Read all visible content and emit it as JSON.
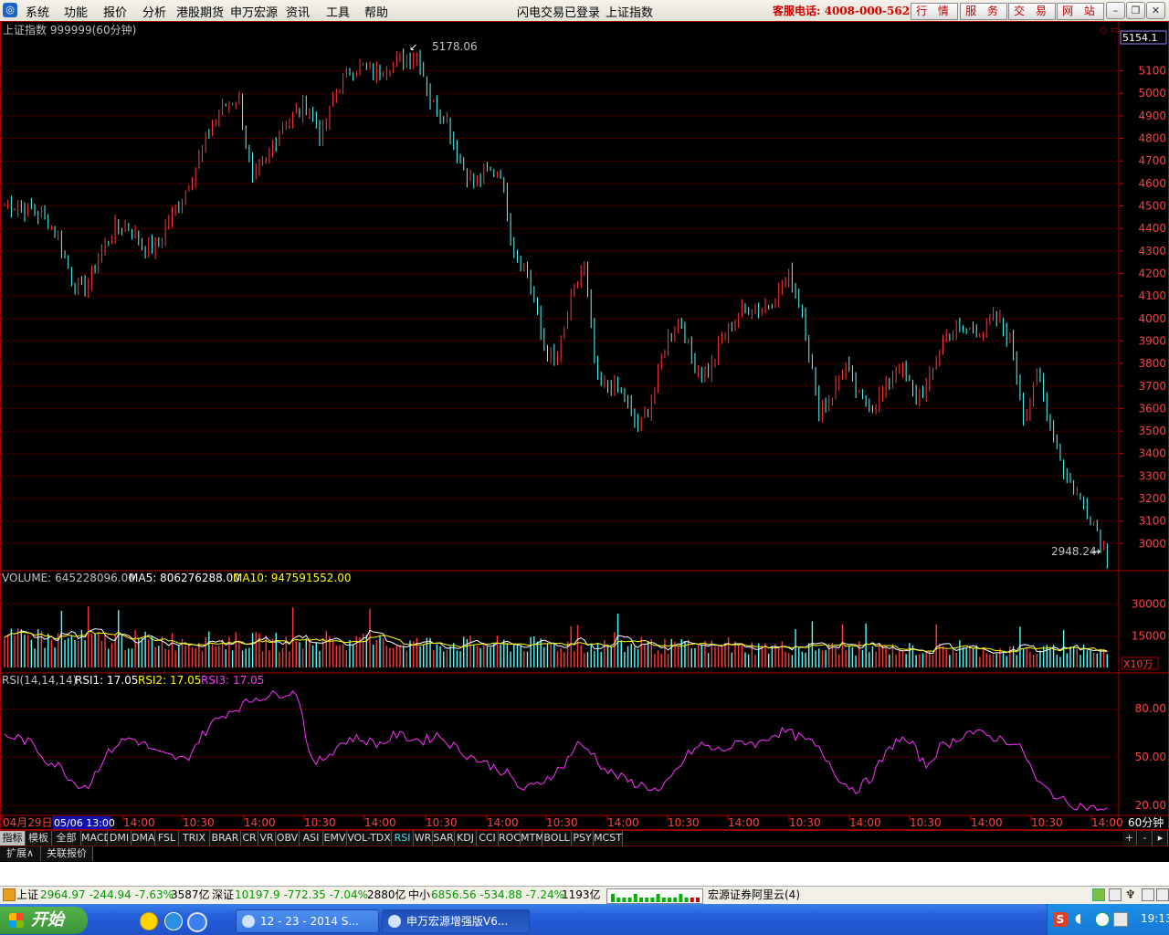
{
  "menu": {
    "items": [
      "系统",
      "功能",
      "报价",
      "分析",
      "港股期货",
      "申万宏源",
      "资讯",
      "工具",
      "帮助"
    ],
    "login_status": "闪电交易已登录",
    "current_index": "上证指数",
    "hotline": "客服电话: 4008-000-562",
    "buttons": [
      "行 情",
      "服 务",
      "交 易",
      "网 站"
    ]
  },
  "chart": {
    "title": "上证指数 999999(60分钟)",
    "price_label": "5154.1",
    "high_label": "5178.06",
    "low_label": "2948.24",
    "price_axis": [
      "5100",
      "5000",
      "4900",
      "4800",
      "4700",
      "4600",
      "4500",
      "4400",
      "4300",
      "4200",
      "4100",
      "4000",
      "3900",
      "3800",
      "3700",
      "3600",
      "3500",
      "3400",
      "3300",
      "3200",
      "3100",
      "3000"
    ],
    "volume_header": {
      "label": "VOLUME: 645228096.00",
      "ma5": "MA5: 806276288.00",
      "ma10": "MA10: 947591552.00"
    },
    "volume_axis": [
      "30000",
      "15000"
    ],
    "volume_unit": "X10万",
    "rsi_header": {
      "label": "RSI(14,14,14)",
      "rsi1": "RSI1: 17.05",
      "rsi2": "RSI2: 17.05",
      "rsi3": "RSI3: 17.05"
    },
    "rsi_axis": [
      "80.00",
      "50.00",
      "20.00"
    ],
    "time_axis": [
      "04月29日",
      "05/06 13:00",
      "14:00",
      "10:30",
      "14:00",
      "10:30",
      "14:00",
      "10:30",
      "14:00",
      "10:30",
      "14:00",
      "10:30",
      "14:00",
      "10:30",
      "14:00",
      "10:30",
      "14:00",
      "10:30",
      "14:00"
    ],
    "period": "60分钟",
    "colors": {
      "up": "#ff3a3a",
      "down": "#54ffff",
      "volume_ma5": "#ffffff",
      "volume_ma10": "#ffff00",
      "rsi": "#ff33ff",
      "grid": "#8a0000"
    }
  },
  "chart_data": {
    "type": "candlestick",
    "title": "上证指数 999999(60分钟)",
    "ylim": [
      2900,
      5220
    ],
    "high": 5178.06,
    "low": 2948.24,
    "close_path": [
      4510,
      4500,
      4480,
      4450,
      4350,
      4150,
      4140,
      4300,
      4400,
      4410,
      4330,
      4300,
      4450,
      4550,
      4700,
      4850,
      4950,
      4980,
      4600,
      4700,
      4850,
      4900,
      4950,
      4800,
      5000,
      5100,
      5120,
      5090,
      5130,
      5160,
      5170,
      4950,
      4900,
      4700,
      4600,
      4650,
      4650,
      4280,
      4200,
      3900,
      3800,
      4050,
      4250,
      3700,
      3700,
      3650,
      3500,
      3650,
      3900,
      4000,
      3800,
      3750,
      3900,
      4000,
      4050,
      4050,
      4100,
      4200,
      4000,
      3600,
      3650,
      3800,
      3650,
      3600,
      3700,
      3800,
      3650,
      3700,
      3900,
      3950,
      3950,
      3950,
      4000,
      3900,
      3550,
      3750,
      3500,
      3300,
      3200,
      3100,
      2950
    ],
    "volume": {
      "value": 645228096.0,
      "ma5": 806276288.0,
      "ma10": 947591552.0,
      "unit": "X10万",
      "ylim": [
        0,
        38000
      ]
    },
    "rsi": {
      "rsi1": 17.05,
      "rsi2": 17.05,
      "rsi3": 17.05,
      "ylim": [
        15,
        92
      ],
      "values": [
        63,
        62,
        58,
        48,
        44,
        34,
        32,
        48,
        58,
        62,
        58,
        52,
        50,
        48,
        62,
        72,
        78,
        82,
        87,
        88,
        90,
        91,
        45,
        50,
        58,
        62,
        60,
        58,
        64,
        62,
        60,
        64,
        58,
        52,
        48,
        44,
        40,
        30,
        32,
        38,
        44,
        58,
        54,
        42,
        38,
        34,
        32,
        28,
        40,
        52,
        58,
        54,
        56,
        60,
        58,
        64,
        66,
        62,
        58,
        48,
        34,
        30,
        36,
        50,
        62,
        58,
        44,
        56,
        60,
        66,
        64,
        62,
        60,
        54,
        34,
        28,
        22,
        20,
        18,
        17
      ]
    },
    "period": "60分钟"
  },
  "tabs": {
    "row1": [
      "指标",
      "模板",
      "全部",
      "MACD",
      "DMI",
      "DMA",
      "FSL",
      "TRIX",
      "BRAR",
      "CR",
      "VR",
      "OBV",
      "ASI",
      "EMV",
      "VOL-TDX",
      "RSI",
      "WR",
      "SAR",
      "KDJ",
      "CCI",
      "ROC",
      "MTM",
      "BOLL",
      "PSY",
      "MCST"
    ],
    "row2": [
      "扩展∧",
      "关联报价"
    ],
    "zoom": [
      "+",
      "-"
    ]
  },
  "status": {
    "sh_name": "上证",
    "sh_val": "2964.97 -244.94 -7.63%",
    "sh_amt": "3587亿",
    "sz_name": "深证",
    "sz_val": "10197.9 -772.35 -7.04%",
    "sz_amt": "2880亿",
    "zx_name": "中小",
    "zx_val": "6856.56 -534.88 -7.24%",
    "zx_amt": "1193亿",
    "broker": "宏源证券阿里云(4)"
  },
  "taskbar": {
    "start": "开始",
    "tasks": [
      "12 - 23 - 2014 S...",
      "申万宏源增强版V6..."
    ],
    "clock": "19:13"
  }
}
